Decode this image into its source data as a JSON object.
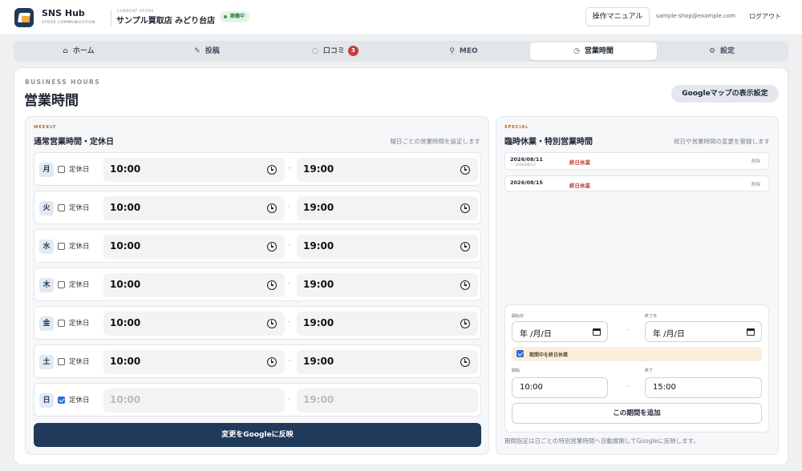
{
  "header": {
    "brand": "SNS Hub",
    "brand_sub": "STORE COMMUNICATION",
    "store_eyebrow": "CURRENT STORE",
    "store_name": "サンプル買取店 みどり台店",
    "status_badge": "稼働中",
    "manual_button": "操作マニュアル",
    "user_email": "sample-shop@example.com",
    "logout": "ログアウト"
  },
  "tabs": [
    {
      "label": "ホーム",
      "icon": "home-icon"
    },
    {
      "label": "投稿",
      "icon": "edit-icon"
    },
    {
      "label": "口コミ",
      "icon": "chat-icon",
      "count": "3"
    },
    {
      "label": "MEO",
      "icon": "map-pin-icon"
    },
    {
      "label": "営業時間",
      "icon": "clock-icon",
      "active": true
    },
    {
      "label": "設定",
      "icon": "gear-icon"
    }
  ],
  "page": {
    "eyebrow": "BUSINESS HOURS",
    "title": "営業時間",
    "gmap_button": "Googleマップの表示設定"
  },
  "weekly": {
    "eyebrow": "WEEKLY",
    "title": "通常営業時間・定休日",
    "note": "曜日ごとの営業時間を設定します",
    "closed_label": "定休日",
    "days": [
      {
        "day": "月",
        "closed": false,
        "open": "10:00",
        "close": "19:00"
      },
      {
        "day": "火",
        "closed": false,
        "open": "10:00",
        "close": "19:00"
      },
      {
        "day": "水",
        "closed": false,
        "open": "10:00",
        "close": "19:00"
      },
      {
        "day": "木",
        "closed": false,
        "open": "10:00",
        "close": "19:00"
      },
      {
        "day": "金",
        "closed": false,
        "open": "10:00",
        "close": "19:00"
      },
      {
        "day": "土",
        "closed": false,
        "open": "10:00",
        "close": "19:00"
      },
      {
        "day": "日",
        "closed": true,
        "open": "10:00",
        "close": "19:00"
      }
    ],
    "apply_button": "変更をGoogleに反映"
  },
  "special": {
    "eyebrow": "SPECIAL",
    "title": "臨時休業・特別営業時間",
    "note": "祝日や営業時間の変更を登録します",
    "items": [
      {
        "date": "2026/08/11",
        "date_to": "— 2026/08/12",
        "status": "終日休業",
        "delete": "削除"
      },
      {
        "date": "2026/08/15",
        "date_to": "",
        "status": "終日休業",
        "delete": "削除"
      }
    ],
    "form": {
      "start_date_label": "開始日",
      "end_date_label": "終了日",
      "start_date_value": "年 /月/日",
      "end_date_value": "年 /月/日",
      "all_day_label": "期間中を終日休業",
      "all_day_checked": true,
      "start_time_label": "開始",
      "end_time_label": "終了",
      "start_time_value": "10:00",
      "end_time_value": "15:00",
      "add_button": "この期間を追加"
    },
    "footnote": "期間指定は日ごとの特別営業時間へ自動展開してGoogleに反映します。"
  },
  "colors": {
    "primary": "#1f3a5a",
    "accent_orange": "#b2641c",
    "danger": "#c2403a",
    "success": "#2fa14a"
  }
}
